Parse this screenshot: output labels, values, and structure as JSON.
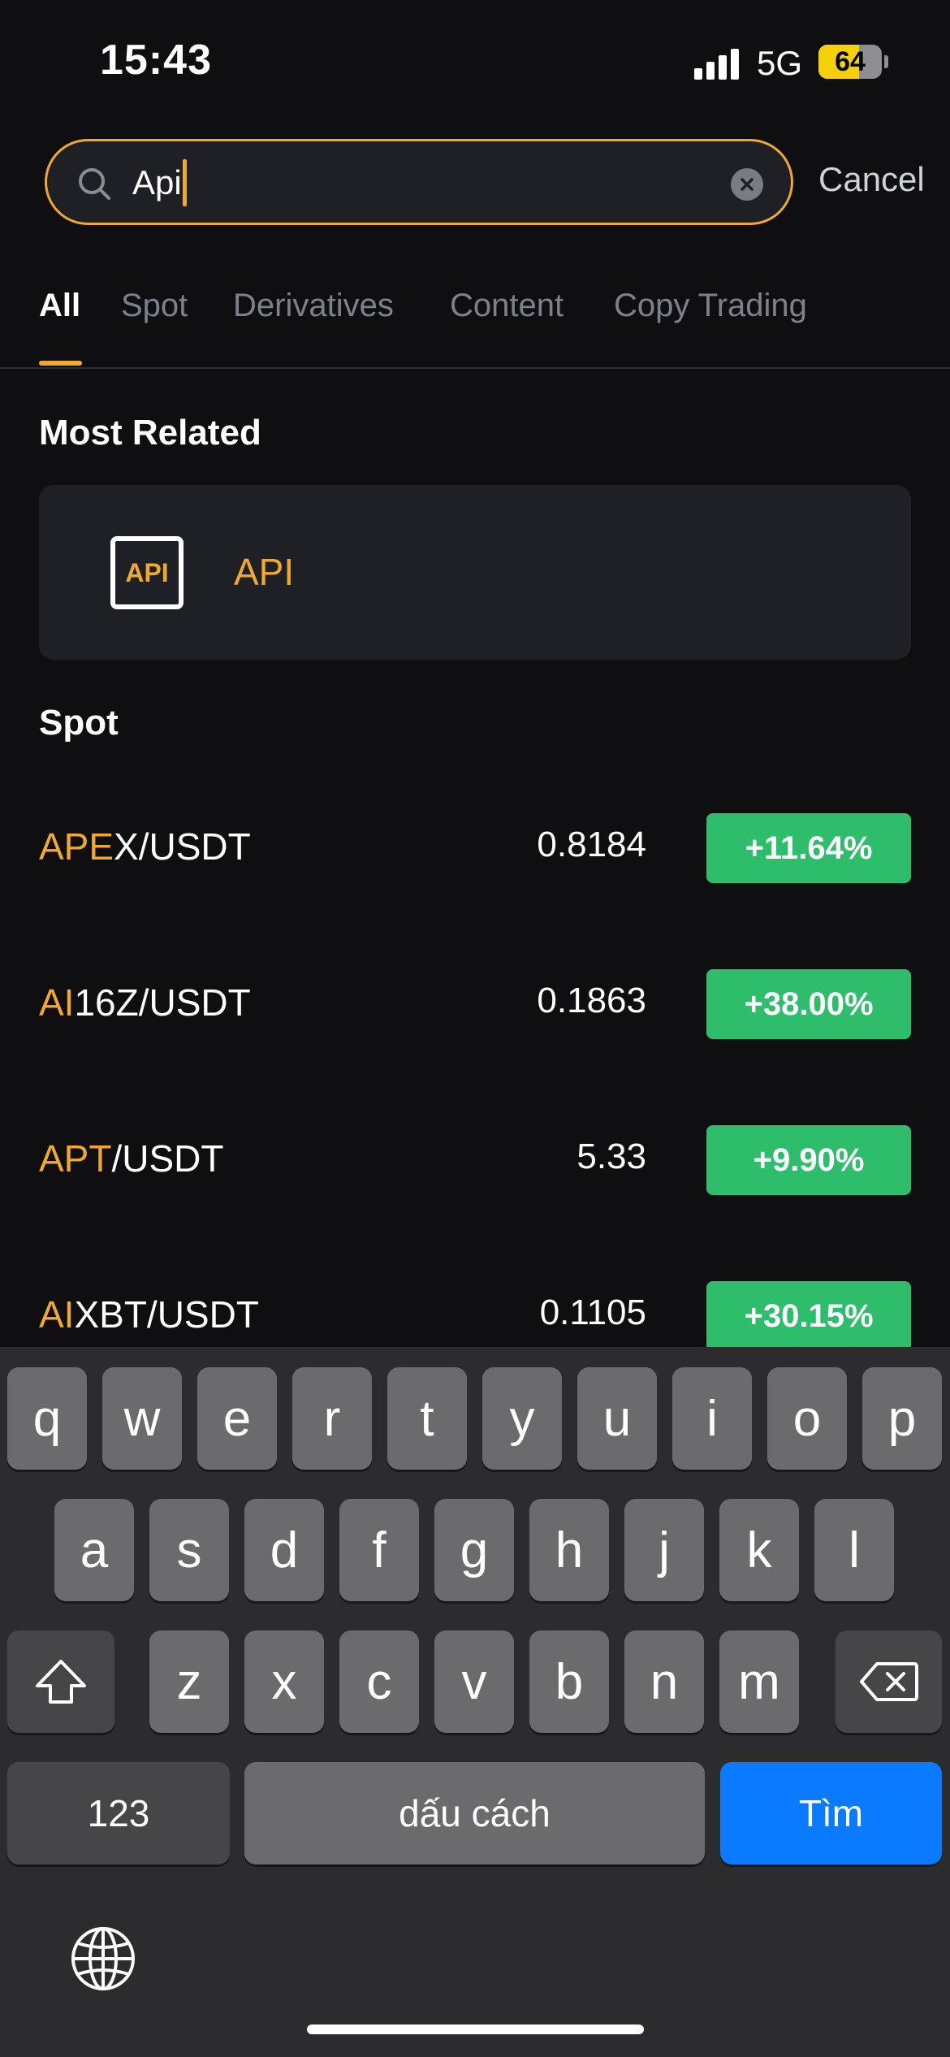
{
  "status_bar": {
    "time": "15:43",
    "network": "5G",
    "battery": "64",
    "battery_level": 0.64
  },
  "search": {
    "value": "Api",
    "cancel_label": "Cancel"
  },
  "tabs": [
    {
      "label": "All",
      "active": true
    },
    {
      "label": "Spot",
      "active": false
    },
    {
      "label": "Derivatives",
      "active": false
    },
    {
      "label": "Content",
      "active": false
    },
    {
      "label": "Copy Trading",
      "active": false
    }
  ],
  "most_related": {
    "title": "Most Related",
    "item": {
      "icon_text": "API",
      "label": "API"
    }
  },
  "spot": {
    "title": "Spot",
    "rows": [
      {
        "highlight": "APE",
        "rest": "X/USDT",
        "price": "0.8184",
        "change": "+11.64%"
      },
      {
        "highlight": "AI",
        "rest": "16Z/USDT",
        "price": "0.1863",
        "change": "+38.00%"
      },
      {
        "highlight": "APT",
        "rest": "/USDT",
        "price": "5.33",
        "change": "+9.90%"
      },
      {
        "highlight": "AI",
        "rest": "XBT/USDT",
        "price": "0.1105",
        "change": "+30.15%"
      }
    ]
  },
  "keyboard": {
    "row1": [
      "q",
      "w",
      "e",
      "r",
      "t",
      "y",
      "u",
      "i",
      "o",
      "p"
    ],
    "row2": [
      "a",
      "s",
      "d",
      "f",
      "g",
      "h",
      "j",
      "k",
      "l"
    ],
    "row3": [
      "z",
      "x",
      "c",
      "v",
      "b",
      "n",
      "m"
    ],
    "numbers_label": "123",
    "space_label": "dấu cách",
    "search_label": "Tìm"
  },
  "colors": {
    "accent": "#f0a92e",
    "positive": "#2ebd6b",
    "background": "#0f0f12",
    "card": "#1e2026",
    "keyboard_blue": "#0a7aff"
  }
}
